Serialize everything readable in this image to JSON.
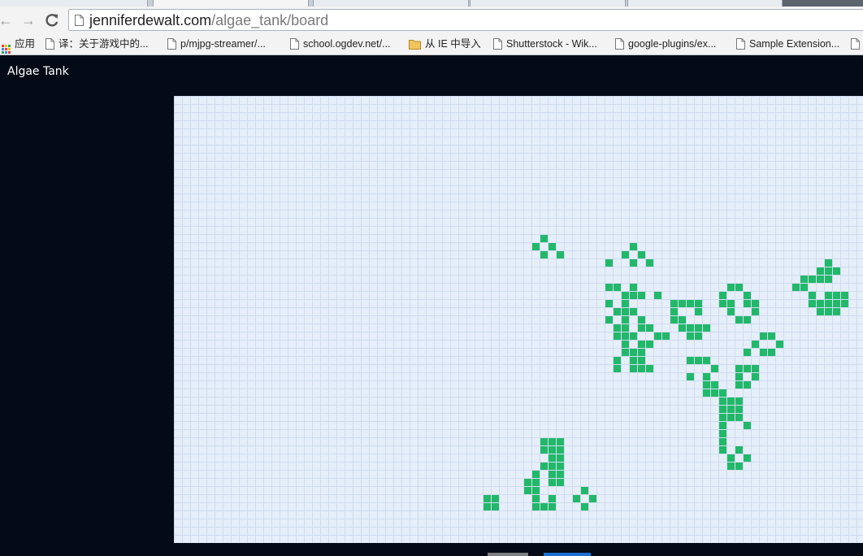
{
  "browser": {
    "url_host": "jenniferdewalt.com",
    "url_path": "/algae_tank/board",
    "bookmarks": [
      {
        "label": "应用",
        "icon": "apps-icon"
      },
      {
        "label": "译：关于游戏中的...",
        "icon": "page-icon"
      },
      {
        "label": "p/mjpg-streamer/...",
        "icon": "page-icon"
      },
      {
        "label": "school.ogdev.net/...",
        "icon": "page-icon"
      },
      {
        "label": "从 IE 中导入",
        "icon": "folder-icon"
      },
      {
        "label": "Shutterstock - Wik...",
        "icon": "page-icon"
      },
      {
        "label": "google-plugins/ex...",
        "icon": "page-icon"
      },
      {
        "label": "Sample Extension...",
        "icon": "page-icon"
      }
    ]
  },
  "app": {
    "title": "Algae Tank",
    "colors": {
      "page_bg": "#050b16",
      "board_bg": "#e6eefa",
      "grid_line": "#cfdced",
      "live_cell": "#22b86a"
    },
    "board": {
      "cols": 85,
      "rows": 55,
      "live_cells": [
        [
          45,
          17
        ],
        [
          44,
          18
        ],
        [
          46,
          18
        ],
        [
          45,
          19
        ],
        [
          47,
          19
        ],
        [
          56,
          18
        ],
        [
          55,
          19
        ],
        [
          57,
          19
        ],
        [
          53,
          20
        ],
        [
          56,
          20
        ],
        [
          58,
          20
        ],
        [
          53,
          23
        ],
        [
          53,
          25
        ],
        [
          54,
          23
        ],
        [
          56,
          23
        ],
        [
          55,
          24
        ],
        [
          55,
          25
        ],
        [
          56,
          24
        ],
        [
          57,
          24
        ],
        [
          59,
          24
        ],
        [
          54,
          26
        ],
        [
          55,
          26
        ],
        [
          56,
          26
        ],
        [
          53,
          27
        ],
        [
          55,
          27
        ],
        [
          57,
          27
        ],
        [
          54,
          28
        ],
        [
          55,
          28
        ],
        [
          57,
          28
        ],
        [
          58,
          28
        ],
        [
          54,
          29
        ],
        [
          55,
          29
        ],
        [
          56,
          29
        ],
        [
          59,
          29
        ],
        [
          55,
          30
        ],
        [
          57,
          30
        ],
        [
          58,
          30
        ],
        [
          55,
          31
        ],
        [
          56,
          31
        ],
        [
          57,
          31
        ],
        [
          54,
          32
        ],
        [
          56,
          32
        ],
        [
          57,
          32
        ],
        [
          54,
          33
        ],
        [
          56,
          33
        ],
        [
          57,
          33
        ],
        [
          58,
          33
        ],
        [
          61,
          25
        ],
        [
          62,
          25
        ],
        [
          61,
          26
        ],
        [
          63,
          25
        ],
        [
          64,
          25
        ],
        [
          64,
          26
        ],
        [
          62,
          27
        ],
        [
          63,
          28
        ],
        [
          62,
          28
        ],
        [
          61,
          27
        ],
        [
          60,
          29
        ],
        [
          64,
          28
        ],
        [
          65,
          28
        ],
        [
          63,
          29
        ],
        [
          64,
          29
        ],
        [
          68,
          23
        ],
        [
          69,
          23
        ],
        [
          67,
          24
        ],
        [
          70,
          24
        ],
        [
          67,
          25
        ],
        [
          68,
          25
        ],
        [
          70,
          25
        ],
        [
          71,
          25
        ],
        [
          68,
          26
        ],
        [
          71,
          26
        ],
        [
          69,
          27
        ],
        [
          70,
          27
        ],
        [
          72,
          29
        ],
        [
          73,
          29
        ],
        [
          71,
          30
        ],
        [
          74,
          30
        ],
        [
          70,
          31
        ],
        [
          72,
          31
        ],
        [
          73,
          31
        ],
        [
          63,
          32
        ],
        [
          64,
          32
        ],
        [
          65,
          32
        ],
        [
          66,
          33
        ],
        [
          63,
          34
        ],
        [
          65,
          34
        ],
        [
          69,
          33
        ],
        [
          70,
          33
        ],
        [
          71,
          33
        ],
        [
          69,
          34
        ],
        [
          71,
          34
        ],
        [
          65,
          35
        ],
        [
          66,
          35
        ],
        [
          65,
          36
        ],
        [
          66,
          36
        ],
        [
          67,
          36
        ],
        [
          69,
          35
        ],
        [
          70,
          35
        ],
        [
          67,
          37
        ],
        [
          68,
          37
        ],
        [
          69,
          37
        ],
        [
          68,
          38
        ],
        [
          69,
          38
        ],
        [
          67,
          38
        ],
        [
          68,
          39
        ],
        [
          69,
          39
        ],
        [
          67,
          39
        ],
        [
          67,
          40
        ],
        [
          67,
          41
        ],
        [
          70,
          40
        ],
        [
          67,
          42
        ],
        [
          67,
          43
        ],
        [
          69,
          43
        ],
        [
          68,
          44
        ],
        [
          70,
          44
        ],
        [
          69,
          45
        ],
        [
          68,
          45
        ],
        [
          80,
          20
        ],
        [
          79,
          21
        ],
        [
          80,
          21
        ],
        [
          81,
          21
        ],
        [
          77,
          22
        ],
        [
          78,
          22
        ],
        [
          79,
          22
        ],
        [
          80,
          22
        ],
        [
          76,
          23
        ],
        [
          77,
          23
        ],
        [
          78,
          24
        ],
        [
          80,
          24
        ],
        [
          81,
          24
        ],
        [
          78,
          25
        ],
        [
          79,
          25
        ],
        [
          80,
          25
        ],
        [
          81,
          25
        ],
        [
          79,
          26
        ],
        [
          80,
          26
        ],
        [
          81,
          26
        ],
        [
          82,
          24
        ],
        [
          82,
          25
        ],
        [
          45,
          42
        ],
        [
          46,
          42
        ],
        [
          47,
          42
        ],
        [
          45,
          43
        ],
        [
          46,
          43
        ],
        [
          47,
          43
        ],
        [
          46,
          44
        ],
        [
          47,
          44
        ],
        [
          45,
          45
        ],
        [
          46,
          45
        ],
        [
          47,
          45
        ],
        [
          44,
          46
        ],
        [
          46,
          46
        ],
        [
          47,
          46
        ],
        [
          43,
          47
        ],
        [
          44,
          47
        ],
        [
          46,
          47
        ],
        [
          47,
          47
        ],
        [
          43,
          48
        ],
        [
          44,
          48
        ],
        [
          44,
          49
        ],
        [
          46,
          49
        ],
        [
          45,
          50
        ],
        [
          46,
          50
        ],
        [
          44,
          50
        ],
        [
          50,
          48
        ],
        [
          49,
          49
        ],
        [
          51,
          49
        ],
        [
          50,
          50
        ],
        [
          38,
          49
        ],
        [
          39,
          49
        ],
        [
          38,
          50
        ],
        [
          39,
          50
        ]
      ]
    },
    "controls": [
      {
        "name": "control-button-gray",
        "color": "#808080"
      },
      {
        "name": "control-button-blue",
        "color": "#1a6fd1"
      }
    ]
  }
}
